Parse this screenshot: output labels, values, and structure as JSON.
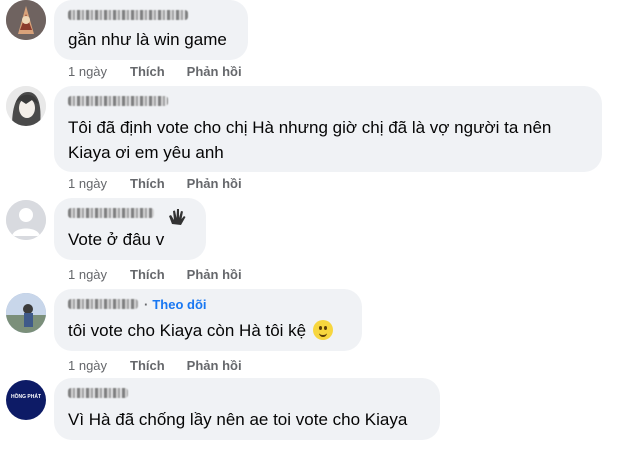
{
  "actions": {
    "like": "Thích",
    "reply": "Phản hồi"
  },
  "comments": [
    {
      "time": "1 ngày",
      "text": "gần như là win game"
    },
    {
      "time": "1 ngày",
      "text_lines": [
        "Tôi đã định vote cho chị Hà nhưng giờ chị đã là vợ người ta nên",
        "Kiaya ơi em yêu anh"
      ]
    },
    {
      "time": "1 ngày",
      "text": "Vote ở đâu v"
    },
    {
      "time": "1 ngày",
      "follow": "Theo dõi",
      "text": "tôi vote cho Kiaya còn Hà tôi kệ",
      "emoji": "slightly-smiling-face"
    },
    {
      "time": "",
      "text": "Vì Hà đã chống lầy nên ae toi vote cho Kiaya",
      "avatar_text": "HỒNG PHÁT"
    }
  ],
  "colors": {
    "bubble": "#f0f2f5",
    "meta": "#65676b",
    "follow": "#1877f2",
    "text": "#050505"
  }
}
